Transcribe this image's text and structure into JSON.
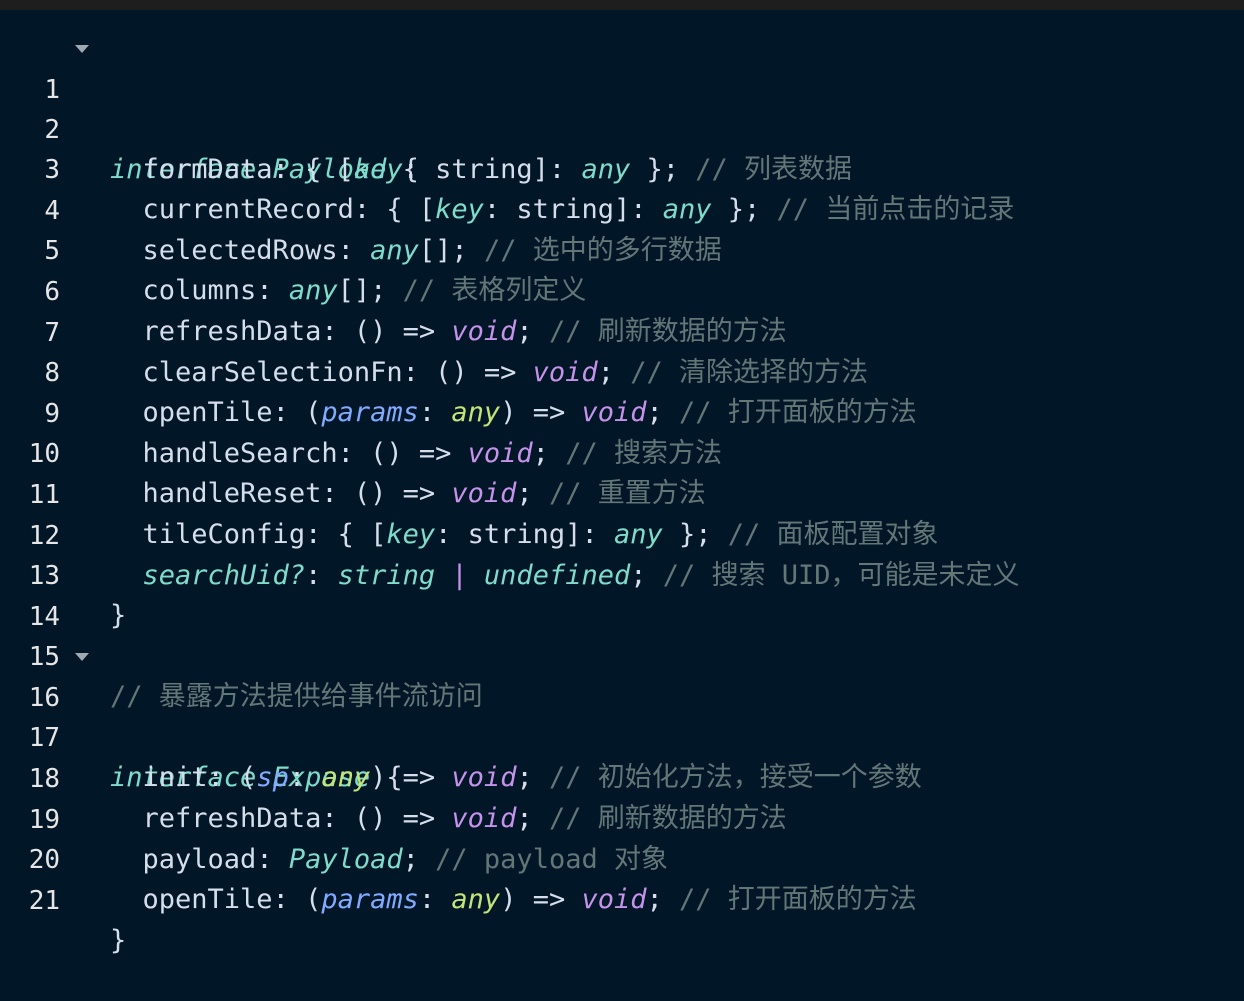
{
  "editor": {
    "lines": [
      {
        "n": "1",
        "fold": true
      },
      {
        "n": "2"
      },
      {
        "n": "3"
      },
      {
        "n": "4"
      },
      {
        "n": "5"
      },
      {
        "n": "6"
      },
      {
        "n": "7"
      },
      {
        "n": "8"
      },
      {
        "n": "9"
      },
      {
        "n": "10"
      },
      {
        "n": "11"
      },
      {
        "n": "12"
      },
      {
        "n": "13"
      },
      {
        "n": "14"
      },
      {
        "n": "15"
      },
      {
        "n": "16",
        "fold": true
      },
      {
        "n": "17"
      },
      {
        "n": "18"
      },
      {
        "n": "19"
      },
      {
        "n": "20"
      },
      {
        "n": "21"
      }
    ],
    "code": {
      "l1": {
        "kw": "interface",
        "name": "Payload",
        "brace": "{"
      },
      "l2": {
        "prop": "formData",
        "rest1": ": { [",
        "key": "key",
        "rest2": ": string]: ",
        "any": "any",
        "rest3": " };",
        "comment": "// 列表数据"
      },
      "l3": {
        "prop": "currentRecord",
        "rest1": ": { [",
        "key": "key",
        "rest2": ": string]: ",
        "any": "any",
        "rest3": " };",
        "comment": "// 当前点击的记录"
      },
      "l4": {
        "prop": "selectedRows",
        "rest1": ": ",
        "any": "any",
        "rest2": "[];",
        "comment": "// 选中的多行数据"
      },
      "l5": {
        "prop": "columns",
        "rest1": ": ",
        "any": "any",
        "rest2": "[];",
        "comment": "// 表格列定义"
      },
      "l6": {
        "prop": "refreshData",
        "rest1": ": () => ",
        "void": "void",
        "rest2": ";",
        "comment": "// 刷新数据的方法"
      },
      "l7": {
        "prop": "clearSelectionFn",
        "rest1": ": () => ",
        "void": "void",
        "rest2": ";",
        "comment": "// 清除选择的方法"
      },
      "l8": {
        "prop": "openTile",
        "rest1": ": (",
        "param": "params",
        "rest2": ": ",
        "any": "any",
        "rest3": ") => ",
        "void": "void",
        "rest4": ";",
        "comment": "// 打开面板的方法"
      },
      "l9": {
        "prop": "handleSearch",
        "rest1": ": () => ",
        "void": "void",
        "rest2": ";",
        "comment": "// 搜索方法"
      },
      "l10": {
        "prop": "handleReset",
        "rest1": ": () => ",
        "void": "void",
        "rest2": ";",
        "comment": "// 重置方法"
      },
      "l11": {
        "prop": "tileConfig",
        "rest1": ": { [",
        "key": "key",
        "rest2": ": string]: ",
        "any": "any",
        "rest3": " };",
        "comment": "// 面板配置对象"
      },
      "l12": {
        "prop": "searchUid?",
        "rest1": ": ",
        "t1": "string",
        "pipe": " | ",
        "t2": "undefined",
        "rest2": ";",
        "comment": "// 搜索 UID，可能是未定义"
      },
      "l13": {
        "brace": "}"
      },
      "l15": {
        "comment": "// 暴露方法提供给事件流访问"
      },
      "l16": {
        "kw": "interface",
        "name": "Expose",
        "brace": "{"
      },
      "l17": {
        "prop": "init",
        "rest1": ": (",
        "param": "sp",
        "rest2": ": ",
        "any": "any",
        "rest3": ") => ",
        "void": "void",
        "rest4": ";",
        "comment": "// 初始化方法，接受一个参数"
      },
      "l18": {
        "prop": "refreshData",
        "rest1": ": () => ",
        "void": "void",
        "rest2": ";",
        "comment": "// 刷新数据的方法"
      },
      "l19": {
        "prop": "payload",
        "rest1": ": ",
        "type": "Payload",
        "rest2": ";",
        "comment": "// payload 对象"
      },
      "l20": {
        "prop": "openTile",
        "rest1": ": (",
        "param": "params",
        "rest2": ": ",
        "any": "any",
        "rest3": ") => ",
        "void": "void",
        "rest4": ";",
        "comment": "// 打开面板的方法"
      },
      "l21": {
        "brace": "}"
      }
    }
  }
}
